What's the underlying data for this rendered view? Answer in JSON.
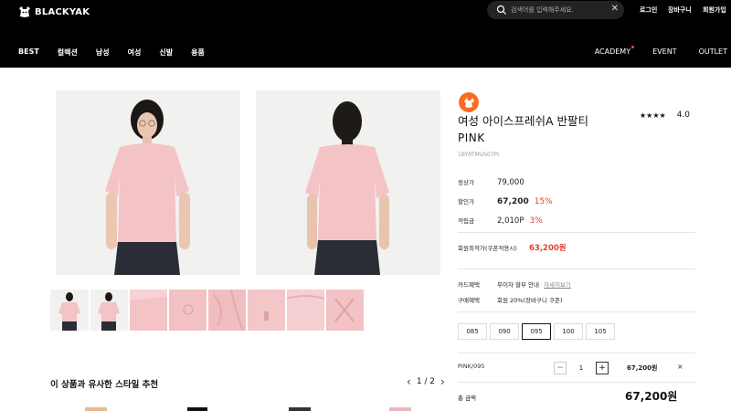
{
  "header": {
    "logo_text": "BLACKYAK",
    "search_placeholder": "검색어를 입력해주세요.",
    "utility": {
      "login": "로그인",
      "cart": "장바구니",
      "join": "회원가입"
    },
    "nav_left": [
      "BEST",
      "컬렉션",
      "남성",
      "여성",
      "신발",
      "용품"
    ],
    "nav_right": [
      "ACADEMY",
      "EVENT",
      "OUTLET"
    ]
  },
  "product": {
    "title": "여성 아이스프레쉬A 반팔티",
    "color": "PINK",
    "code": "1BYRTMUS07PI",
    "rating": {
      "stars": "★★★★",
      "score": "4.0"
    },
    "regular": {
      "label": "정상가",
      "value": "79,000"
    },
    "sale": {
      "label": "할인가",
      "value": "67,200",
      "percent": "15%"
    },
    "points": {
      "label": "적립금",
      "value": "2,010P",
      "percent": "3%"
    },
    "member": {
      "label": "회원최적가(쿠폰적용시)",
      "value": "63,200원"
    },
    "card_benefit": {
      "label": "카드혜택",
      "value": "무이자 할부 안내",
      "link": "자세히보기"
    },
    "buy_benefit": {
      "label": "구매혜택",
      "value": "회원 20%(장바구니 쿠폰)"
    },
    "sizes": [
      "085",
      "090",
      "095",
      "100",
      "105"
    ],
    "selected_size": "095",
    "option": {
      "line": "PINK/095",
      "qty": "1",
      "price": "67,200원",
      "minus": "−",
      "plus": "+",
      "delete": "×"
    },
    "total": {
      "label": "총 금액",
      "value": "67,200원"
    }
  },
  "recommend": {
    "title": "이 상품과 유사한 스타일 추천",
    "page": "1 / 2",
    "prev": "‹",
    "next": "›"
  },
  "colors": {
    "header_bg": "#000000",
    "accent_red": "#e8402c",
    "brand_orange": "#ff6a1f",
    "shirt_pink": "#f3c3c6",
    "image_bg": "#f2f2f0"
  }
}
